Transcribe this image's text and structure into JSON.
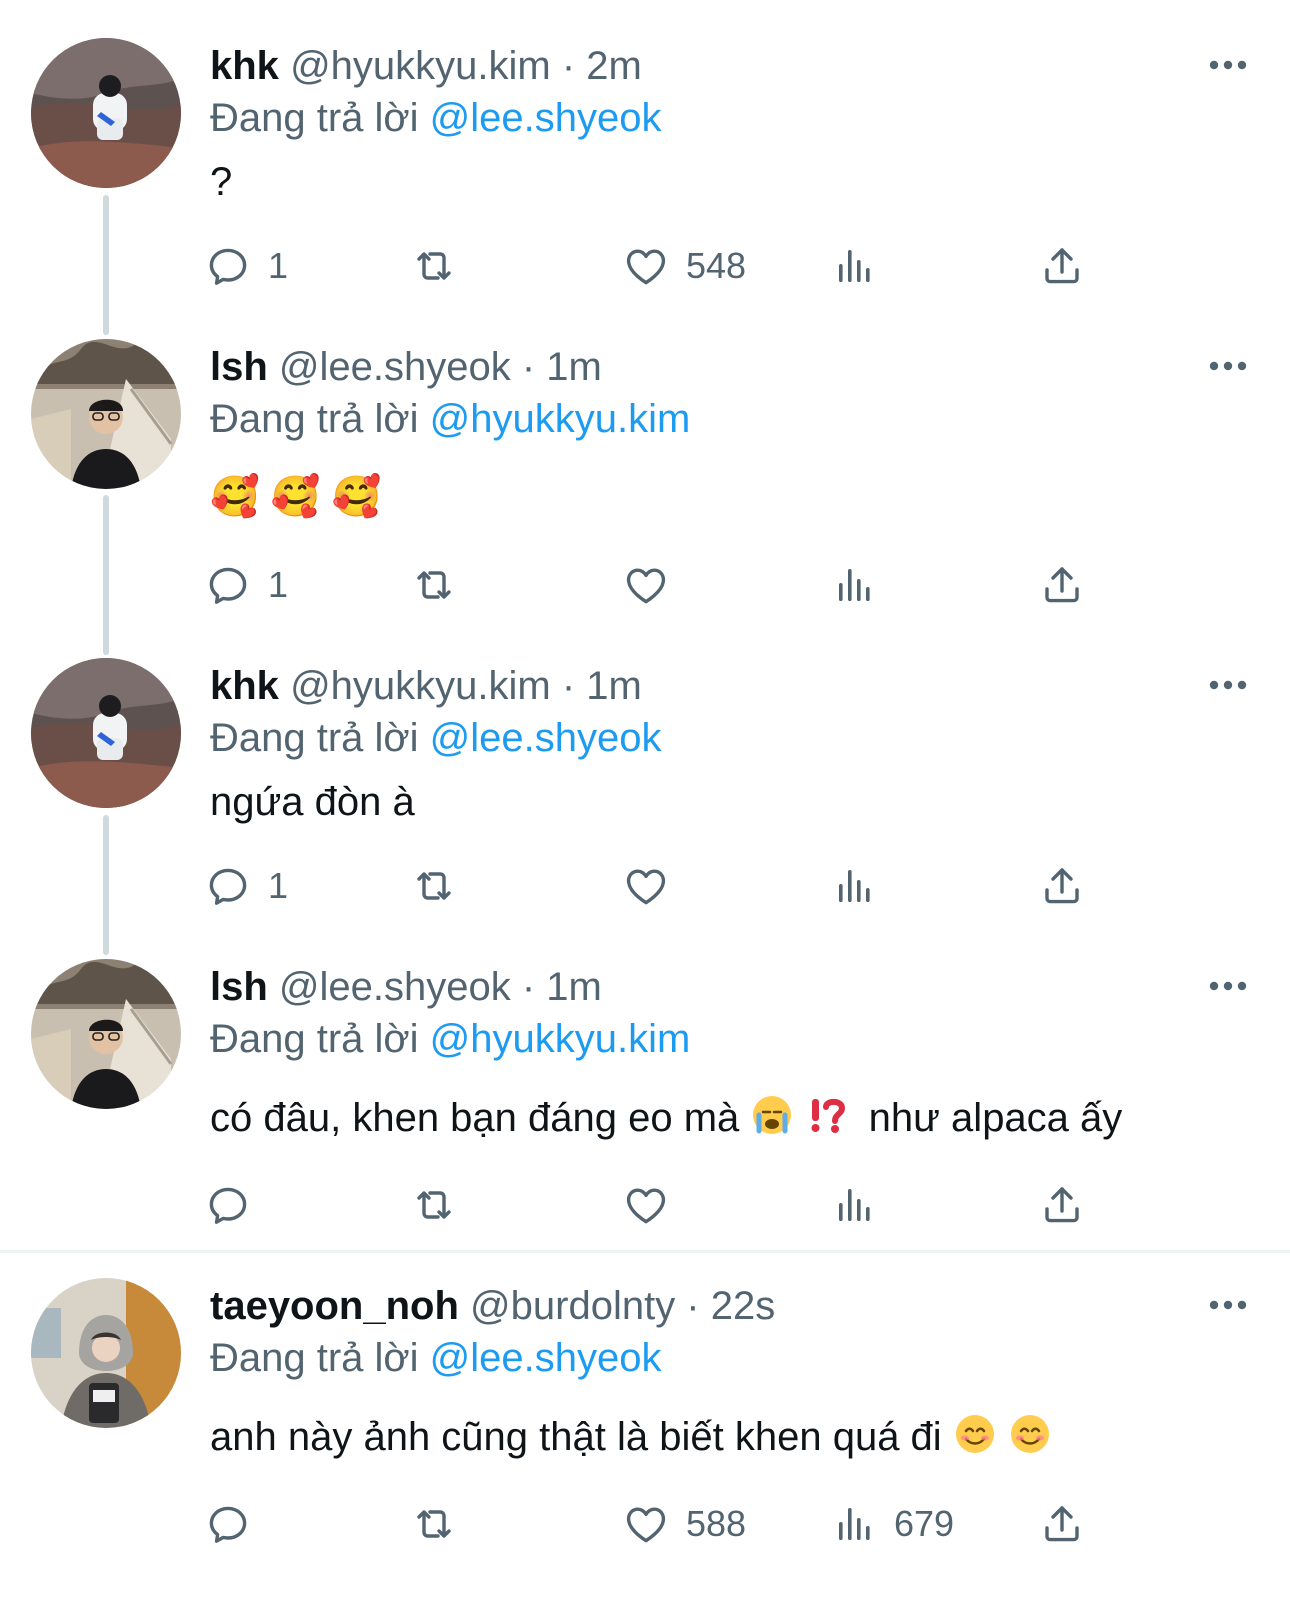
{
  "tweets": [
    {
      "name": "khk",
      "handle": "@hyukkyu.kim · 2m",
      "reply_prefix": "Đang trả lời ",
      "reply_to": "@lee.shyeok",
      "text": "?",
      "reply_count": "1",
      "like_count": "548",
      "view_count": ""
    },
    {
      "name": "lsh",
      "handle": "@lee.shyeok · 1m",
      "reply_prefix": "Đang trả lời ",
      "reply_to": "@hyukkyu.kim",
      "text": "🥰 🥰 🥰",
      "reply_count": "1",
      "like_count": "",
      "view_count": ""
    },
    {
      "name": "khk",
      "handle": "@hyukkyu.kim · 1m",
      "reply_prefix": "Đang trả lời ",
      "reply_to": "@lee.shyeok",
      "text": "ngứa đòn à",
      "reply_count": "1",
      "like_count": "",
      "view_count": ""
    },
    {
      "name": "lsh",
      "handle": "@lee.shyeok · 1m",
      "reply_prefix": "Đang trả lời ",
      "reply_to": "@hyukkyu.kim",
      "text_a": "có đâu, khen bạn đáng eo mà",
      "text_b": "như alpaca ấy",
      "reply_count": "",
      "like_count": "",
      "view_count": ""
    },
    {
      "name": "taeyoon_noh",
      "handle": "@burdolnty · 22s",
      "reply_prefix": "Đang trả lời ",
      "reply_to": "@lee.shyeok",
      "text": "anh này ảnh cũng thật là biết khen quá đi",
      "reply_count": "",
      "like_count": "588",
      "view_count": "679"
    }
  ],
  "icons": {
    "reply": "reply-icon",
    "retweet": "retweet-icon",
    "like": "heart-icon",
    "views": "views-icon",
    "share": "share-icon",
    "more": "more-icon"
  },
  "colors": {
    "link": "#1d9bf0",
    "secondary": "#536471",
    "thread_line": "#cfd9de",
    "divider": "#eff3f4"
  }
}
